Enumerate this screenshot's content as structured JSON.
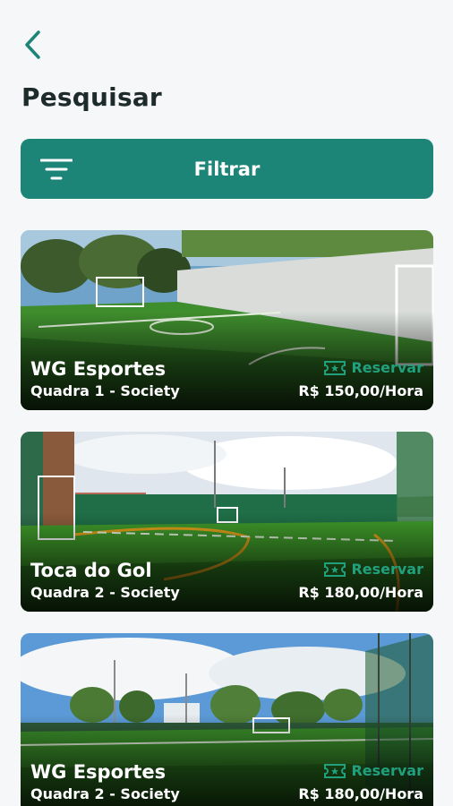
{
  "header": {
    "title": "Pesquisar",
    "back_icon": "chevron-left-icon"
  },
  "filter": {
    "label": "Filtrar",
    "icon": "filter-icon"
  },
  "colors": {
    "accent": "#1d8577",
    "reserve": "#21a07e",
    "text_dark": "#1d2b2a"
  },
  "courts": [
    {
      "venue": "WG Esportes",
      "court": "Quadra 1 - Society",
      "reserve_label": "Reservar",
      "price": "R$ 150,00/Hora"
    },
    {
      "venue": "Toca do Gol",
      "court": "Quadra 2 - Society",
      "reserve_label": "Reservar",
      "price": "R$ 180,00/Hora"
    },
    {
      "venue": "WG Esportes",
      "court": "Quadra 2 - Society",
      "reserve_label": "Reservar",
      "price": "R$ 180,00/Hora"
    }
  ]
}
